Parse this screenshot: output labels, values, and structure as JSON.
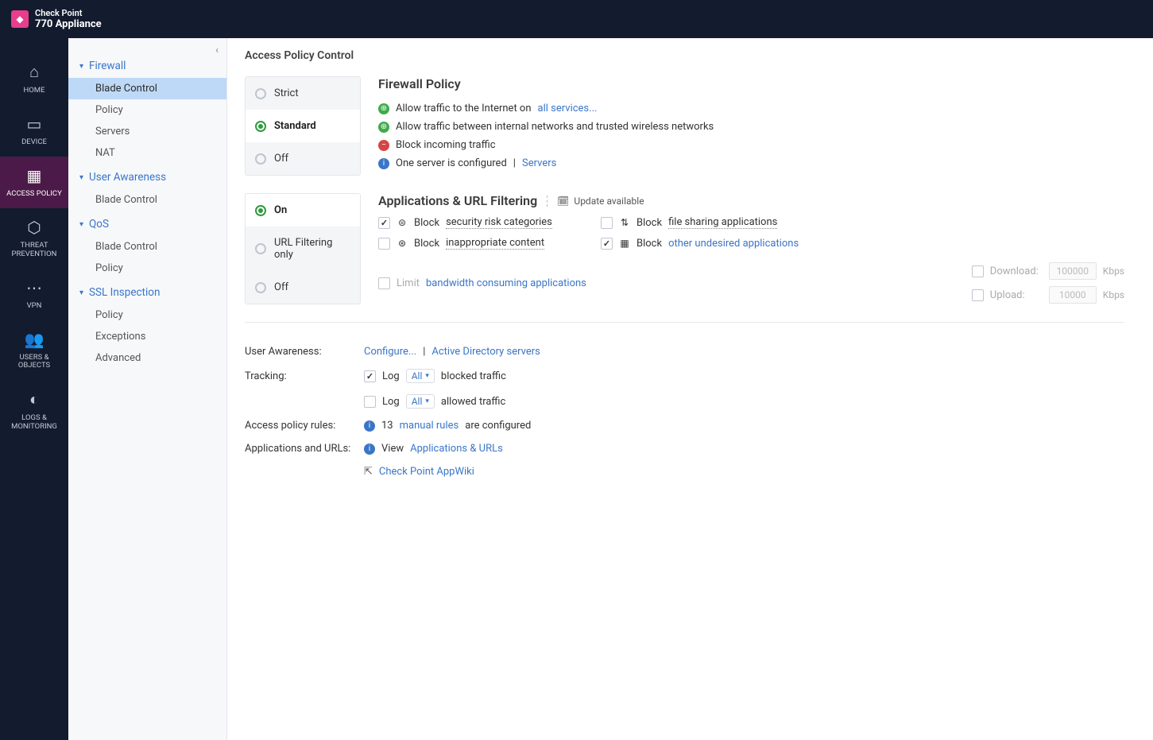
{
  "brand": {
    "line1": "Check Point",
    "line2": "770 Appliance"
  },
  "rail": [
    {
      "id": "home",
      "label": "HOME"
    },
    {
      "id": "device",
      "label": "DEVICE"
    },
    {
      "id": "access-policy",
      "label": "ACCESS POLICY"
    },
    {
      "id": "threat-prevention",
      "label": "THREAT PREVENTION"
    },
    {
      "id": "vpn",
      "label": "VPN"
    },
    {
      "id": "users-objects",
      "label": "USERS & OBJECTS"
    },
    {
      "id": "logs-monitoring",
      "label": "LOGS & MONITORING"
    }
  ],
  "nav": {
    "groups": [
      {
        "title": "Firewall",
        "items": [
          "Blade Control",
          "Policy",
          "Servers",
          "NAT"
        ],
        "active": 0
      },
      {
        "title": "User Awareness",
        "items": [
          "Blade Control"
        ]
      },
      {
        "title": "QoS",
        "items": [
          "Blade Control",
          "Policy"
        ]
      },
      {
        "title": "SSL Inspection",
        "items": [
          "Policy",
          "Exceptions",
          "Advanced"
        ]
      }
    ]
  },
  "page": {
    "title": "Access Policy Control"
  },
  "firewall_policy": {
    "title": "Firewall Policy",
    "levels": [
      "Strict",
      "Standard",
      "Off"
    ],
    "selected": "Standard",
    "rules": {
      "allow_internet_pre": "Allow traffic to the Internet on ",
      "allow_internet_link": "all services...",
      "allow_internal": "Allow traffic between internal networks and trusted wireless networks",
      "block_incoming": "Block incoming traffic",
      "server_info_pre": "One server is configured",
      "server_sep": " | ",
      "server_link": "Servers"
    }
  },
  "apps_url": {
    "title": "Applications & URL Filtering",
    "update": "Update available",
    "levels": [
      "On",
      "URL Filtering only",
      "Off"
    ],
    "selected": "On",
    "checks": {
      "sec_risk": {
        "label_pre": "Block ",
        "label_link": "security risk categories",
        "checked": true
      },
      "file_share": {
        "label_pre": "Block ",
        "label_link": "file sharing applications",
        "checked": false
      },
      "inapp": {
        "label_pre": "Block ",
        "label_link": "inappropriate content",
        "checked": false
      },
      "other": {
        "label_pre": "Block  ",
        "label_link": "other undesired applications",
        "checked": true
      }
    },
    "limit": {
      "label_pre": "Limit ",
      "label_link": "bandwidth consuming applications",
      "checked": false,
      "download_label": "Download:",
      "download_val": "100000",
      "upload_label": "Upload:",
      "upload_val": "10000",
      "unit": "Kbps"
    }
  },
  "user_awareness": {
    "label": "User Awareness:",
    "configure": "Configure...",
    "sep": " | ",
    "ad": "Active Directory servers"
  },
  "tracking": {
    "label": "Tracking:",
    "log_word": "Log",
    "sel": "All",
    "blocked": "blocked traffic",
    "allowed": "allowed traffic",
    "blocked_checked": true,
    "allowed_checked": false
  },
  "access_rules": {
    "label": "Access policy rules:",
    "count": "13",
    "link": "manual rules",
    "suffix": " are configured"
  },
  "apps_urls_row": {
    "label": "Applications and URLs:",
    "view": "View ",
    "link": "Applications & URLs",
    "appwiki": "Check Point AppWiki"
  }
}
